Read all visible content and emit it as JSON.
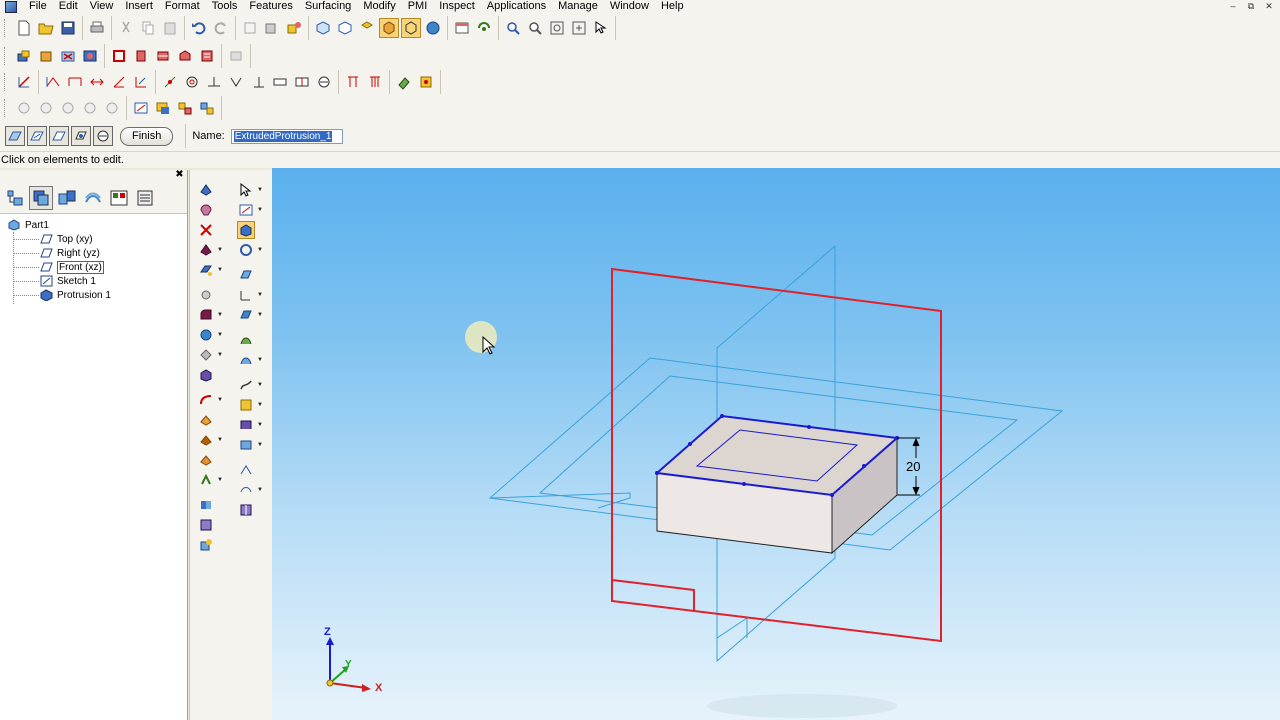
{
  "menu": {
    "items": [
      "File",
      "Edit",
      "View",
      "Insert",
      "Format",
      "Tools",
      "Features",
      "Surfacing",
      "Modify",
      "PMI",
      "Inspect",
      "Applications",
      "Manage",
      "Window",
      "Help"
    ]
  },
  "ribbon": {
    "finish_label": "Finish",
    "name_label": "Name:",
    "name_value": "ExtrudedProtrusion_1"
  },
  "status": {
    "prompt": "Click on elements to edit."
  },
  "tree": {
    "root": "Part1",
    "items": [
      "Top (xy)",
      "Right (yz)",
      "Front (xz)",
      "Sketch 1",
      "Protrusion 1"
    ]
  },
  "viewport": {
    "dimension_value": "20",
    "axis_z": "Z",
    "axis_y": "Y",
    "axis_x": "X"
  },
  "colors": {
    "plane_selected": "#e0202a",
    "plane_normal": "#3aa2d8",
    "edge_highlight": "#1a1ad0",
    "body_top": "#ddd5cf",
    "body_side": "#c9c3c6"
  }
}
